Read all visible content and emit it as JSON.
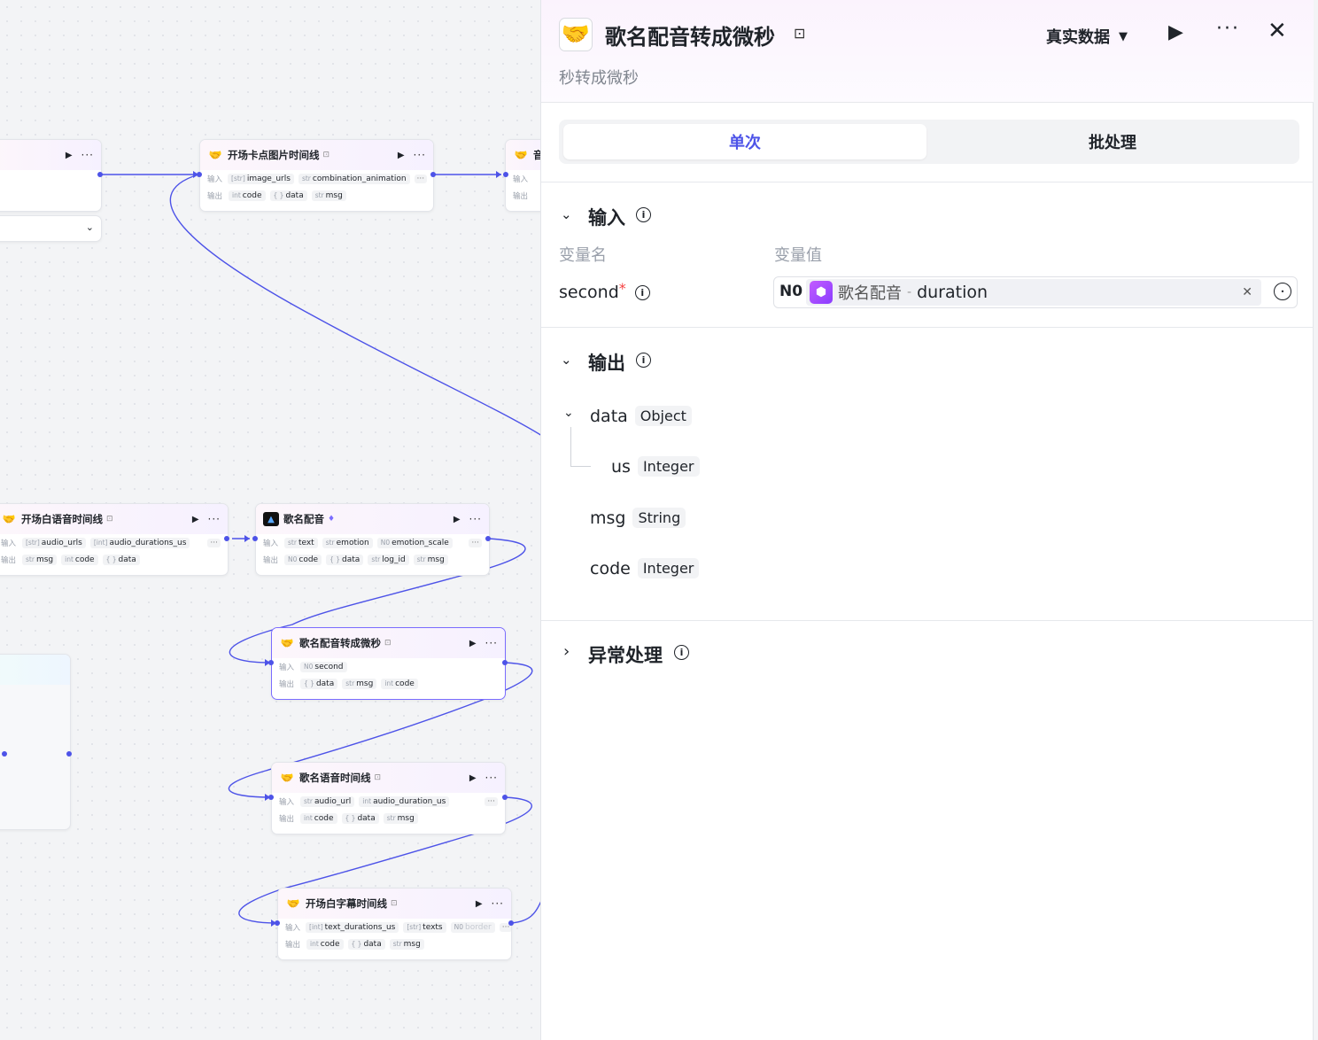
{
  "canvas": {
    "nodes": [
      {
        "id": "n_prev",
        "title": "",
        "inputs": [],
        "outputs": []
      },
      {
        "id": "n_kadian",
        "title": "开场卡点图片时间线",
        "in_label": "输入",
        "out_label": "输出",
        "inputs": [
          {
            "type": "[str]",
            "name": "image_urls"
          },
          {
            "type": "str",
            "name": "combination_animation"
          }
        ],
        "outputs": [
          {
            "type": "int",
            "name": "code"
          },
          {
            "type": "{ }",
            "name": "data"
          },
          {
            "type": "str",
            "name": "msg"
          }
        ]
      },
      {
        "id": "n_yin",
        "title": "音",
        "in_label": "输入",
        "out_label": "输出",
        "inputs": [],
        "outputs": []
      },
      {
        "id": "n_kaichang_voice",
        "title": "开场白语音时间线",
        "in_label": "输入",
        "out_label": "输出",
        "inputs": [
          {
            "type": "[str]",
            "name": "audio_urls"
          },
          {
            "type": "[int]",
            "name": "audio_durations_us"
          }
        ],
        "outputs": [
          {
            "type": "str",
            "name": "msg"
          },
          {
            "type": "int",
            "name": "code"
          },
          {
            "type": "{ }",
            "name": "data"
          }
        ]
      },
      {
        "id": "n_gemingpeiyin",
        "title": "歌名配音",
        "in_label": "输入",
        "out_label": "输出",
        "inputs": [
          {
            "type": "str",
            "name": "text"
          },
          {
            "type": "str",
            "name": "emotion"
          },
          {
            "type": "N0",
            "name": "emotion_scale"
          }
        ],
        "outputs": [
          {
            "type": "N0",
            "name": "code"
          },
          {
            "type": "{ }",
            "name": "data"
          },
          {
            "type": "str",
            "name": "log_id"
          },
          {
            "type": "str",
            "name": "msg"
          }
        ]
      },
      {
        "id": "n_convert",
        "title": "歌名配音转成微秒",
        "in_label": "输入",
        "out_label": "输出",
        "inputs": [
          {
            "type": "N0",
            "name": "second"
          }
        ],
        "outputs": [
          {
            "type": "{ }",
            "name": "data"
          },
          {
            "type": "str",
            "name": "msg"
          },
          {
            "type": "int",
            "name": "code"
          }
        ]
      },
      {
        "id": "n_voice_timeline",
        "title": "歌名语音时间线",
        "in_label": "输入",
        "out_label": "输出",
        "inputs": [
          {
            "type": "str",
            "name": "audio_url"
          },
          {
            "type": "int",
            "name": "audio_duration_us"
          }
        ],
        "outputs": [
          {
            "type": "int",
            "name": "code"
          },
          {
            "type": "{ }",
            "name": "data"
          },
          {
            "type": "str",
            "name": "msg"
          }
        ]
      },
      {
        "id": "n_subtitle",
        "title": "开场白字幕时间线",
        "in_label": "输入",
        "out_label": "输出",
        "inputs": [
          {
            "type": "[int]",
            "name": "text_durations_us"
          },
          {
            "type": "[str]",
            "name": "texts"
          },
          {
            "type": "N0",
            "name": "border"
          }
        ],
        "outputs": [
          {
            "type": "int",
            "name": "code"
          },
          {
            "type": "{ }",
            "name": "data"
          },
          {
            "type": "str",
            "name": "msg"
          }
        ]
      }
    ]
  },
  "panel": {
    "title": "歌名配音转成微秒",
    "subtitle": "秒转成微秒",
    "data_mode": "真实数据",
    "tabs": [
      "单次",
      "批处理"
    ],
    "input_section": {
      "title": "输入",
      "col_name": "变量名",
      "col_value": "变量值",
      "var_name": "second",
      "required_mark": "*",
      "value_type": "N0",
      "value_source": "歌名配音",
      "value_sep": "-",
      "value_field": "duration"
    },
    "output_section": {
      "title": "输出",
      "fields": [
        {
          "name": "data",
          "type": "Object"
        },
        {
          "name": "us",
          "type": "Integer"
        },
        {
          "name": "msg",
          "type": "String"
        },
        {
          "name": "code",
          "type": "Integer"
        }
      ]
    },
    "error_section": {
      "title": "异常处理"
    },
    "colors": {
      "accent": "#4d53e8",
      "selected_border": "#7a6cff",
      "edge": "#4d53e8"
    }
  }
}
